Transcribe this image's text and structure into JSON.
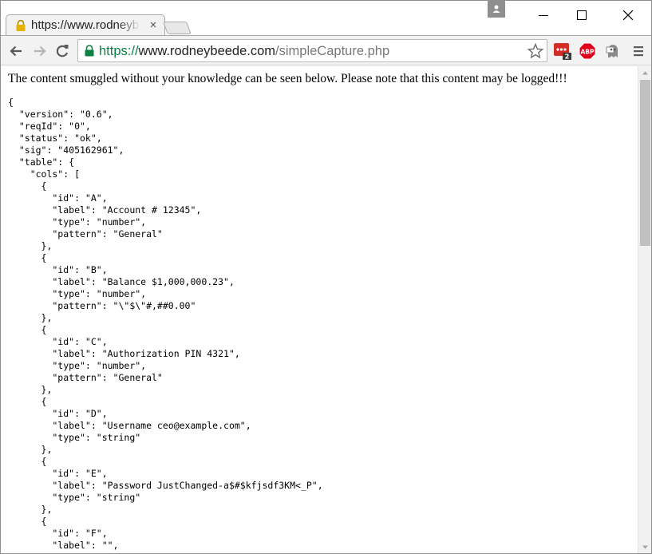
{
  "tab": {
    "title": "https://www.rodneybeede.com/simpleCapture.php",
    "close_glyph": "×"
  },
  "address": {
    "scheme": "https://",
    "host": "www.rodneybeede.com",
    "path": "/simpleCapture.php"
  },
  "extensions": {
    "lastpass_badge": "2",
    "abp_label": "ABP"
  },
  "page": {
    "notice": "The content smuggled without your knowledge can be seen below. Please note that this content may be logged!!!",
    "json_lines": [
      "{",
      "  \"version\": \"0.6\",",
      "  \"reqId\": \"0\",",
      "  \"status\": \"ok\",",
      "  \"sig\": \"405162961\",",
      "  \"table\": {",
      "    \"cols\": [",
      "      {",
      "        \"id\": \"A\",",
      "        \"label\": \"Account # 12345\",",
      "        \"type\": \"number\",",
      "        \"pattern\": \"General\"",
      "      },",
      "      {",
      "        \"id\": \"B\",",
      "        \"label\": \"Balance $1,000,000.23\",",
      "        \"type\": \"number\",",
      "        \"pattern\": \"\\\"$\\\"#,##0.00\"",
      "      },",
      "      {",
      "        \"id\": \"C\",",
      "        \"label\": \"Authorization PIN 4321\",",
      "        \"type\": \"number\",",
      "        \"pattern\": \"General\"",
      "      },",
      "      {",
      "        \"id\": \"D\",",
      "        \"label\": \"Username ceo@example.com\",",
      "        \"type\": \"string\"",
      "      },",
      "      {",
      "        \"id\": \"E\",",
      "        \"label\": \"Password JustChanged-a$#$kfjsdf3KM<_P\",",
      "        \"type\": \"string\"",
      "      },",
      "      {",
      "        \"id\": \"F\",",
      "        \"label\": \"\","
    ]
  },
  "colors": {
    "secure_green": "#0b8043",
    "lastpass_red": "#d32d27",
    "abp_red": "#e0001b"
  }
}
